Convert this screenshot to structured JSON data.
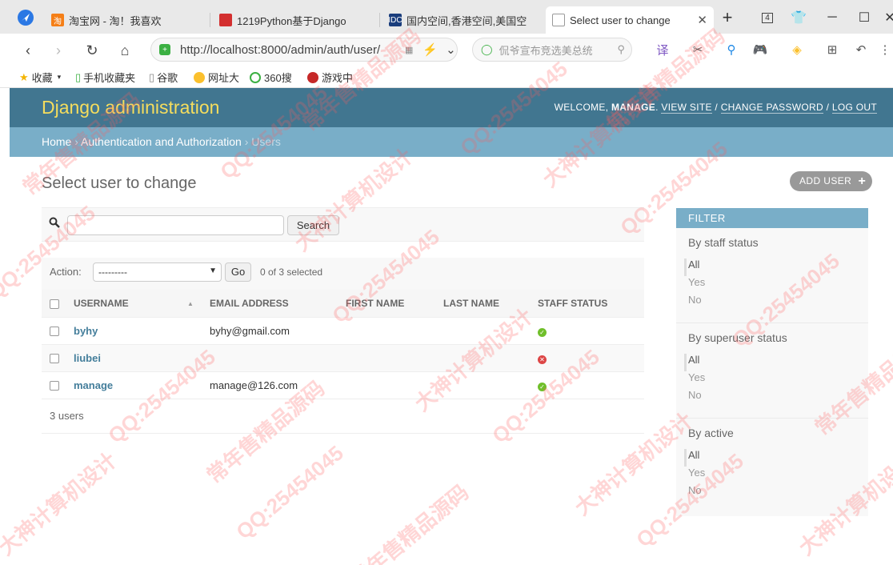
{
  "browser": {
    "tabs": [
      {
        "label": "淘宝网 - 淘！我喜欢",
        "favicon_color": "#f57f17"
      },
      {
        "label": "1219Python基于Django",
        "favicon_color": "#d32f2f"
      },
      {
        "label": "国内空间,香港空间,美国空",
        "favicon_color": "#1a3d7c"
      },
      {
        "label": "Select user to change",
        "favicon_color": "#9e9e9e"
      }
    ],
    "url": "http://localhost:8000/admin/auth/user/",
    "search_placeholder": "侃爷宣布竞选美总统",
    "tab_count": "4",
    "bookmarks": [
      {
        "label": "收藏",
        "icon": "star-icon"
      },
      {
        "label": "手机收藏夹",
        "icon": "phone-icon"
      },
      {
        "label": "谷歌",
        "icon": "page-icon"
      },
      {
        "label": "网址大",
        "icon": "globe-icon"
      },
      {
        "label": "360搜",
        "icon": "search-icon"
      },
      {
        "label": "游戏中",
        "icon": "game-icon"
      }
    ]
  },
  "header": {
    "brand": "Django administration",
    "welcome": "WELCOME,",
    "username": "MANAGE",
    "view_site": "VIEW SITE",
    "change_password": "CHANGE PASSWORD",
    "log_out": "LOG OUT"
  },
  "breadcrumbs": {
    "home": "Home",
    "section": "Authentication and Authorization",
    "current": "Users"
  },
  "content": {
    "title": "Select user to change",
    "add_button": "ADD USER",
    "search_button": "Search",
    "search_value": "",
    "action_label": "Action:",
    "action_selected": "---------",
    "go_button": "Go",
    "selected_count": "0 of 3 selected",
    "paginator": "3 users"
  },
  "table": {
    "columns": [
      "USERNAME",
      "EMAIL ADDRESS",
      "FIRST NAME",
      "LAST NAME",
      "STAFF STATUS"
    ],
    "rows": [
      {
        "username": "byhy",
        "email": "byhy@gmail.com",
        "first_name": "",
        "last_name": "",
        "staff": true
      },
      {
        "username": "liubei",
        "email": "",
        "first_name": "",
        "last_name": "",
        "staff": false
      },
      {
        "username": "manage",
        "email": "manage@126.com",
        "first_name": "",
        "last_name": "",
        "staff": true
      }
    ]
  },
  "filter": {
    "title": "FILTER",
    "groups": [
      {
        "title": "By staff status",
        "options": [
          "All",
          "Yes",
          "No"
        ]
      },
      {
        "title": "By superuser status",
        "options": [
          "All",
          "Yes",
          "No"
        ]
      },
      {
        "title": "By active",
        "options": [
          "All",
          "Yes",
          "No"
        ]
      }
    ]
  },
  "colors": {
    "header": "#417690",
    "brand": "#f5dd5d",
    "breadcrumbs": "#79aec8",
    "link": "#447e9b",
    "ok": "#70bf2b",
    "no": "#dd4646"
  },
  "watermark": [
    "QQ:25454045",
    "大神计算机设计",
    "常年售精品源码"
  ]
}
